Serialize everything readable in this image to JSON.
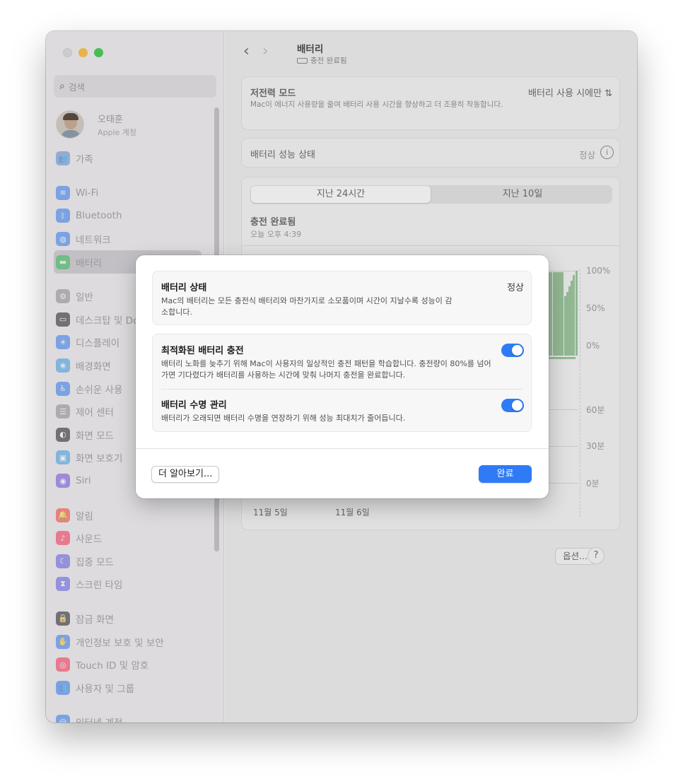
{
  "sidebar": {
    "search_placeholder": "검색",
    "profile": {
      "name": "오태훈",
      "subtitle": "Apple 계정"
    },
    "items": [
      {
        "label": "가족",
        "icon": "family-icon",
        "color": "#5a8fd6"
      },
      {
        "label": "Wi-Fi",
        "icon": "wifi-icon",
        "color": "#2f7bf6"
      },
      {
        "label": "Bluetooth",
        "icon": "bluetooth-icon",
        "color": "#2f7bf6"
      },
      {
        "label": "네트워크",
        "icon": "network-icon",
        "color": "#2f7bf6"
      },
      {
        "label": "배터리",
        "icon": "battery-icon",
        "color": "#34c759"
      },
      {
        "label": "일반",
        "icon": "gear-icon",
        "color": "#8e8e93"
      },
      {
        "label": "데스크탑 및 Dock",
        "icon": "dock-icon",
        "color": "#1c1c1e"
      },
      {
        "label": "디스플레이",
        "icon": "display-icon",
        "color": "#2f7bf6"
      },
      {
        "label": "배경화면",
        "icon": "wallpaper-icon",
        "color": "#3aa0e8"
      },
      {
        "label": "손쉬운 사용",
        "icon": "accessibility-icon",
        "color": "#2f7bf6"
      },
      {
        "label": "제어 센터",
        "icon": "control-center-icon",
        "color": "#8e8e93"
      },
      {
        "label": "화면 모드",
        "icon": "appearance-icon",
        "color": "#1c1c1e"
      },
      {
        "label": "화면 보호기",
        "icon": "screensaver-icon",
        "color": "#3aa0e8"
      },
      {
        "label": "Siri",
        "icon": "siri-icon",
        "color": "#6e4ee0"
      },
      {
        "label": "알림",
        "icon": "notifications-icon",
        "color": "#ff3b30"
      },
      {
        "label": "사운드",
        "icon": "sound-icon",
        "color": "#ff2d55"
      },
      {
        "label": "집중 모드",
        "icon": "focus-icon",
        "color": "#5e5ce6"
      },
      {
        "label": "스크린 타임",
        "icon": "screen-time-icon",
        "color": "#5e5ce6"
      },
      {
        "label": "잠금 화면",
        "icon": "lock-icon",
        "color": "#1c1c1e"
      },
      {
        "label": "개인정보 보호 및 보안",
        "icon": "privacy-hand-icon",
        "color": "#2f7bf6"
      },
      {
        "label": "Touch ID 및 암호",
        "icon": "fingerprint-icon",
        "color": "#ff2d55"
      },
      {
        "label": "사용자 및 그룹",
        "icon": "users-icon",
        "color": "#2f7bf6"
      },
      {
        "label": "인터넷 계정",
        "icon": "at-icon",
        "color": "#2f7bf6"
      }
    ]
  },
  "toolbar": {
    "title": "배터리",
    "subtitle": "충전 완료됨"
  },
  "low_power": {
    "title": "저전력 모드",
    "description": "Mac이 에너지 사용량을 줄여 배터리 사용 시간을 향상하고 더 조용히 작동합니다.",
    "value": "배터리 사용 시에만"
  },
  "health": {
    "title": "배터리 성능 상태",
    "value": "정상"
  },
  "usage": {
    "tabs": [
      "지난 24시간",
      "지난 10일"
    ],
    "status": "충전 완료됨",
    "time": "오늘 오후 4:39",
    "level_labels": [
      "100%",
      "50%",
      "0%"
    ],
    "screen_labels": [
      "60분",
      "30분",
      "0분"
    ],
    "dates": [
      "11월 5일",
      "11월 6일"
    ]
  },
  "footer": {
    "options": "옵션...",
    "help": "?"
  },
  "modal": {
    "status_title": "배터리 상태",
    "status_value": "정상",
    "status_desc": "Mac의 배터리는 모든 충전식 배터리와 마찬가지로 소모품이며 시간이 지날수록 성능이 감소합니다.",
    "opt_title": "최적화된 배터리 충전",
    "opt_desc": "배터리 노화를 늦추기 위해 Mac이 사용자의 일상적인 충전 패턴을 학습합니다. 충전량이 80%를 넘어가면 기다렸다가 배터리를 사용하는 시간에 맞춰 나머지 충전을 완료합니다.",
    "opt_on": true,
    "life_title": "배터리 수명 관리",
    "life_desc": "배터리가 오래되면 배터리 수명을 연장하기 위해 성능 최대치가 줄어듭니다.",
    "life_on": true,
    "learn_more": "더 알아보기...",
    "done": "완료"
  }
}
